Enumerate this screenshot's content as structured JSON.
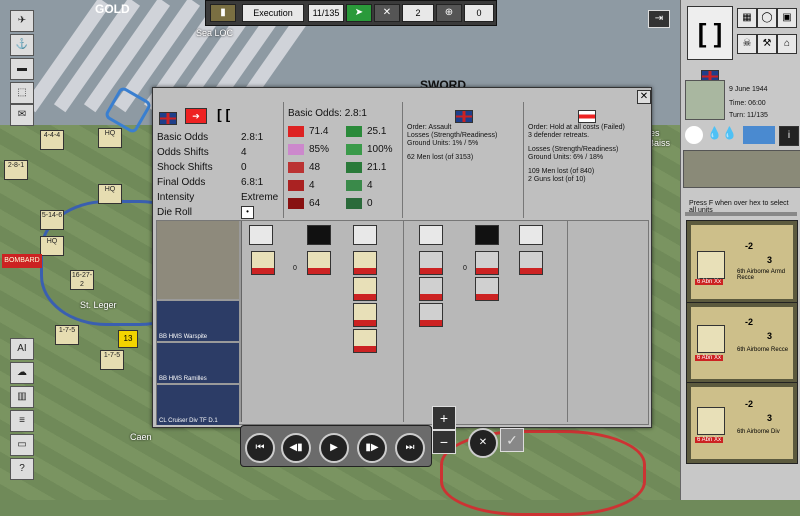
{
  "map": {
    "labels": [
      "GOLD",
      "SWORD",
      "Sea LOC",
      "les Baiss",
      "St. Leger",
      "Caen"
    ],
    "units": [
      "HQ",
      "HQ",
      "HQ",
      "2-8-1",
      "13"
    ],
    "bombard_label": "BOMBARD"
  },
  "topbar": {
    "phase": "Execution",
    "turn_count": "11/135",
    "counter_a": "2",
    "counter_b": "0"
  },
  "dialog": {
    "summary": {
      "basic_odds_label": "Basic Odds",
      "basic_odds": "2.8:1",
      "odds_shifts_label": "Odds Shifts",
      "odds_shifts": "4",
      "shock_shifts_label": "Shock Shifts",
      "shock_shifts": "0",
      "final_odds_label": "Final Odds",
      "final_odds": "6.8:1",
      "intensity_label": "Intensity",
      "intensity": "Extreme",
      "die_roll_label": "Die Roll"
    },
    "odds": {
      "title": "Basic Odds: 2.8:1",
      "attack": [
        "71.4",
        "85%",
        "48",
        "4",
        "64"
      ],
      "defense": [
        "25.1",
        "100%",
        "21.1",
        "4",
        "0"
      ]
    },
    "allied": {
      "order": "Order: Assault",
      "losses": "Losses (Strength/Readiness)",
      "ground": "Ground Units: 1% / 5%",
      "men_lost": "62 Men lost (of 3153)"
    },
    "axis": {
      "order": "Order: Hold at all costs (Failed)",
      "retreat": "3 defender retreats.",
      "losses": "Losses (Strength/Readiness)",
      "ground": "Ground Units: 6% / 18%",
      "men_lost": "109 Men lost (of 840)",
      "guns_lost": "2 Guns lost (of 10)"
    },
    "ships": [
      {
        "type": "BB",
        "name": "HMS Warspite"
      },
      {
        "type": "BB",
        "name": "HMS Ramilles"
      },
      {
        "type": "CL",
        "name": "Cruiser Div TF D.1"
      }
    ],
    "allied_counts": [
      "0",
      "0",
      "0",
      "0"
    ],
    "axis_counts": [
      "0",
      "0"
    ]
  },
  "right_panel": {
    "date": "9 June 1944",
    "time": "Time: 06:00",
    "turn": "Turn: 11/135",
    "hint": "Press F when over hex to select all units",
    "cards": [
      {
        "id": "6 Abn Xx",
        "name": "6th Airborne Armd Recce",
        "values": [
          "-2",
          "3"
        ]
      },
      {
        "id": "6 Abn Xx",
        "name": "6th Airborne Recce",
        "values": [
          "-2",
          "3"
        ]
      },
      {
        "id": "6 Abn Xx",
        "name": "6th Airborne Div",
        "values": [
          "-2",
          "3"
        ]
      }
    ]
  },
  "bottombar": {
    "buttons": [
      "first",
      "prev",
      "play",
      "next",
      "last"
    ]
  },
  "colors": {
    "accent": "#2a9a3a",
    "red": "#cc2222",
    "panel": "#bfbfbf"
  }
}
